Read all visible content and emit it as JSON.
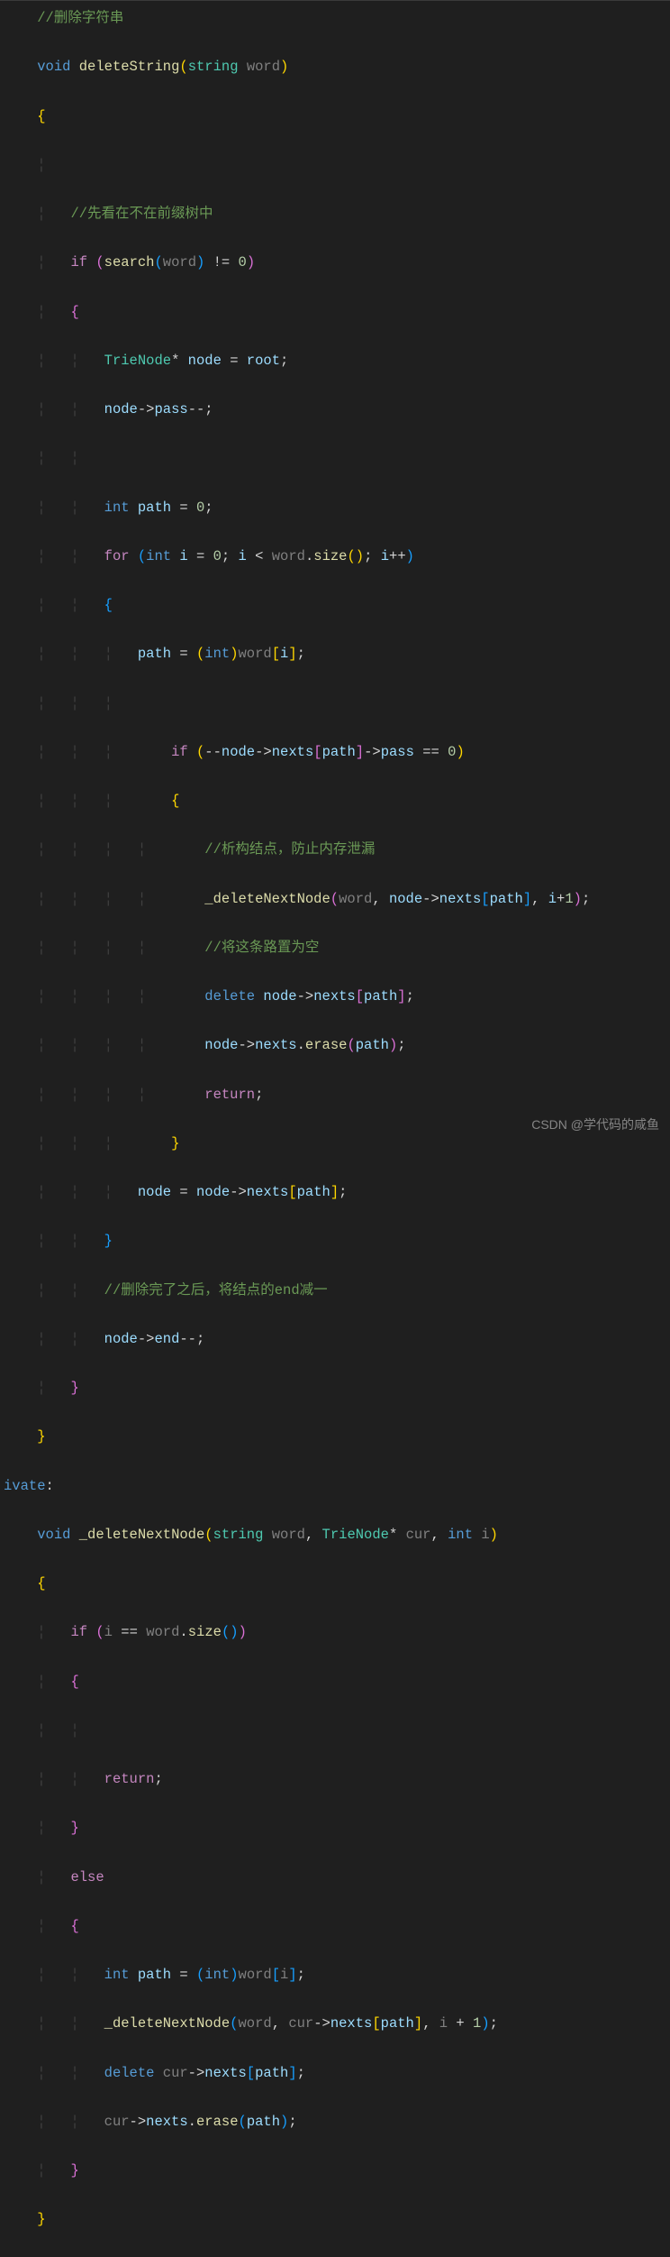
{
  "code": {
    "c1": "//删除字符串",
    "kw_void": "void",
    "fn_delStr": "deleteString",
    "cls_string": "string",
    "p_word": "word",
    "c2": "//先看在不在前缀树中",
    "kw_if": "if",
    "fn_search": "search",
    "num0": "0",
    "cls_TrieNode": "TrieNode",
    "v_node": "node",
    "v_root": "root",
    "v_pass": "pass",
    "kw_int": "int",
    "v_path": "path",
    "kw_for": "for",
    "v_i": "i",
    "fn_size": "size",
    "v_nexts": "nexts",
    "c3": "//析构结点，防止内存泄漏",
    "fn_delNext": "_deleteNextNode",
    "num1": "1",
    "c4": "//将这条路置为空",
    "kw_delete": "delete",
    "fn_erase": "erase",
    "kw_return": "return",
    "c5": "//删除完了之后，将结点的end减一",
    "v_end": "end",
    "kw_private": "ivate",
    "p_cur": "cur",
    "kw_else": "else"
  },
  "watermark": "CSDN @学代码的咸鱼"
}
